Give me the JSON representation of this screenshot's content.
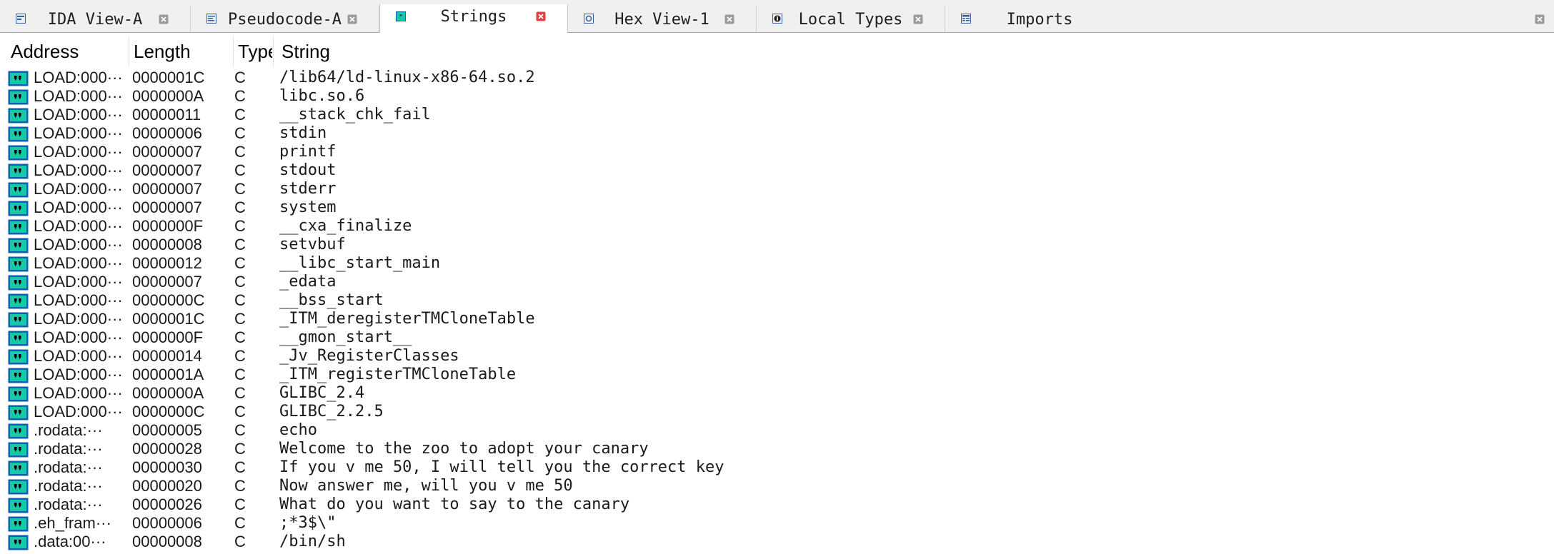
{
  "tabs": [
    {
      "label": "IDA View-A",
      "icon": "ida-view-icon",
      "active": false
    },
    {
      "label": "Pseudocode-A",
      "icon": "pseudocode-icon",
      "active": false
    },
    {
      "label": "Strings",
      "icon": "strings-icon",
      "active": true
    },
    {
      "label": "Hex View-1",
      "icon": "hex-view-icon",
      "active": false
    },
    {
      "label": "Local Types",
      "icon": "local-types-icon",
      "active": false
    },
    {
      "label": "Imports",
      "icon": "imports-icon",
      "active": false
    }
  ],
  "columns": {
    "address": "Address",
    "length": "Length",
    "type": "Type",
    "string": "String"
  },
  "rows": [
    {
      "address": "LOAD:000···",
      "length": "0000001C",
      "type": "C",
      "string": "/lib64/ld-linux-x86-64.so.2"
    },
    {
      "address": "LOAD:000···",
      "length": "0000000A",
      "type": "C",
      "string": "libc.so.6"
    },
    {
      "address": "LOAD:000···",
      "length": "00000011",
      "type": "C",
      "string": "__stack_chk_fail"
    },
    {
      "address": "LOAD:000···",
      "length": "00000006",
      "type": "C",
      "string": "stdin"
    },
    {
      "address": "LOAD:000···",
      "length": "00000007",
      "type": "C",
      "string": "printf"
    },
    {
      "address": "LOAD:000···",
      "length": "00000007",
      "type": "C",
      "string": "stdout"
    },
    {
      "address": "LOAD:000···",
      "length": "00000007",
      "type": "C",
      "string": "stderr"
    },
    {
      "address": "LOAD:000···",
      "length": "00000007",
      "type": "C",
      "string": "system"
    },
    {
      "address": "LOAD:000···",
      "length": "0000000F",
      "type": "C",
      "string": "__cxa_finalize"
    },
    {
      "address": "LOAD:000···",
      "length": "00000008",
      "type": "C",
      "string": "setvbuf"
    },
    {
      "address": "LOAD:000···",
      "length": "00000012",
      "type": "C",
      "string": "__libc_start_main"
    },
    {
      "address": "LOAD:000···",
      "length": "00000007",
      "type": "C",
      "string": "_edata"
    },
    {
      "address": "LOAD:000···",
      "length": "0000000C",
      "type": "C",
      "string": "__bss_start"
    },
    {
      "address": "LOAD:000···",
      "length": "0000001C",
      "type": "C",
      "string": "_ITM_deregisterTMCloneTable"
    },
    {
      "address": "LOAD:000···",
      "length": "0000000F",
      "type": "C",
      "string": "__gmon_start__"
    },
    {
      "address": "LOAD:000···",
      "length": "00000014",
      "type": "C",
      "string": "_Jv_RegisterClasses"
    },
    {
      "address": "LOAD:000···",
      "length": "0000001A",
      "type": "C",
      "string": "_ITM_registerTMCloneTable"
    },
    {
      "address": "LOAD:000···",
      "length": "0000000A",
      "type": "C",
      "string": "GLIBC_2.4"
    },
    {
      "address": "LOAD:000···",
      "length": "0000000C",
      "type": "C",
      "string": "GLIBC_2.2.5"
    },
    {
      "address": ".rodata:···",
      "length": "00000005",
      "type": "C",
      "string": "echo"
    },
    {
      "address": ".rodata:···",
      "length": "00000028",
      "type": "C",
      "string": "Welcome to the zoo to adopt your canary"
    },
    {
      "address": ".rodata:···",
      "length": "00000030",
      "type": "C",
      "string": "If you v me 50, I will tell you the correct key"
    },
    {
      "address": ".rodata:···",
      "length": "00000020",
      "type": "C",
      "string": "Now answer me, will you v me 50"
    },
    {
      "address": ".rodata:···",
      "length": "00000026",
      "type": "C",
      "string": "What do you want to say to the canary"
    },
    {
      "address": ".eh_fram···",
      "length": "00000006",
      "type": "C",
      "string": ";*3$\\\""
    },
    {
      "address": ".data:00···",
      "length": "00000008",
      "type": "C",
      "string": "/bin/sh"
    }
  ],
  "colors": {
    "string_icon_fill": "#18c8a8",
    "string_icon_border": "#1060b0",
    "active_close": "#e04040",
    "inactive_close": "#9a9a9a"
  }
}
